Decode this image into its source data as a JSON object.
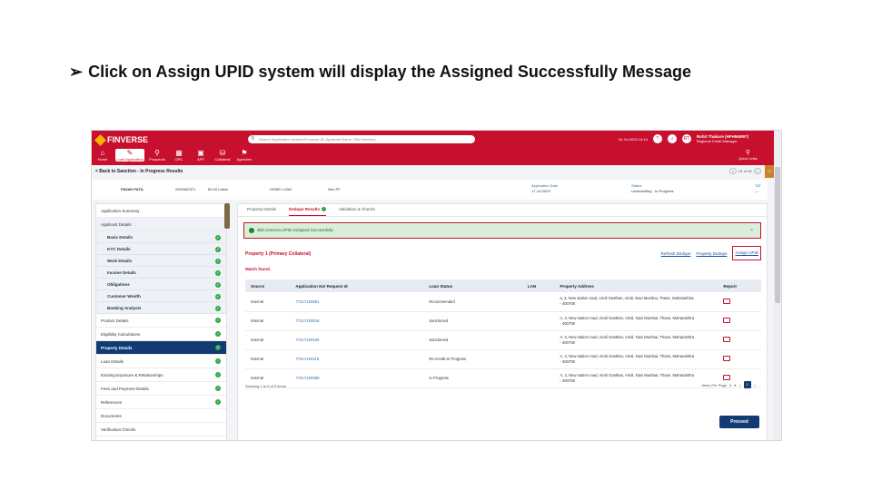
{
  "slide": {
    "bullet": "➢",
    "title": "Click on Assign UPID system will display the Assigned Successfully Message"
  },
  "app": {
    "brand": "FINVERSE",
    "nav": [
      {
        "icon": "⌂",
        "label": "Home"
      },
      {
        "icon": "✎",
        "label": "Loan Application"
      },
      {
        "icon": "⚲",
        "label": "Prospects"
      },
      {
        "icon": "▦",
        "label": "OPC"
      },
      {
        "icon": "▣",
        "label": "APF"
      },
      {
        "icon": "⛁",
        "label": "Collateral"
      },
      {
        "icon": "⚑",
        "label": "Agencies"
      }
    ],
    "search_placeholder": "Search (Application Number/Finverse ID, Applicant Name, PAN Number)",
    "datetime": "04 Jul 2023 14:14",
    "user_name": "Rohit Thakare (HFHM4997)",
    "user_role": "Regional Credit Manager",
    "user_initials": "RT",
    "quick_links": "Quick Links"
  },
  "crumb": "< Back to Sanction - In Progress Results",
  "pager": {
    "text": "01 of 05"
  },
  "info": {
    "name": "PAVAN PATIL",
    "app_no": "2000082371",
    "amount": "80.00 Lakhs",
    "product": "HOME LOAN",
    "dpd": "Non RT",
    "app_date_label": "Application Date",
    "app_date": "17 Jul 2023",
    "status_label": "Status",
    "status": "Underwriting - In Progress",
    "tat_label": "TAT",
    "tat": "—"
  },
  "sidebar": [
    {
      "label": "Application Summary",
      "type": "item",
      "check": false
    },
    {
      "label": "Applicant Details",
      "type": "group",
      "check": false
    },
    {
      "label": "Basic Details",
      "type": "sub",
      "check": true
    },
    {
      "label": "KYC Details",
      "type": "sub",
      "check": true
    },
    {
      "label": "Work Details",
      "type": "sub",
      "check": true
    },
    {
      "label": "Income Details",
      "type": "sub",
      "check": true
    },
    {
      "label": "Obligations",
      "type": "sub",
      "check": true
    },
    {
      "label": "Customer Wealth",
      "type": "sub",
      "check": true
    },
    {
      "label": "Banking Analysis",
      "type": "sub",
      "check": true
    },
    {
      "label": "Product Details",
      "type": "item",
      "check": true
    },
    {
      "label": "Eligibility Calculations",
      "type": "item",
      "check": true
    },
    {
      "label": "Property Details",
      "type": "active",
      "check": true
    },
    {
      "label": "Loan Details",
      "type": "item",
      "check": true
    },
    {
      "label": "Existing Exposure & Relationships",
      "type": "item",
      "check": true
    },
    {
      "label": "Fees and Payment Details",
      "type": "item",
      "check": true
    },
    {
      "label": "References",
      "type": "item",
      "check": true
    },
    {
      "label": "Documents",
      "type": "item",
      "check": false
    },
    {
      "label": "Verification Checks",
      "type": "item",
      "check": false
    },
    {
      "label": "Sourcing Details",
      "type": "item",
      "check": true
    }
  ],
  "tabs": [
    {
      "label": "Property Details",
      "active": false
    },
    {
      "label": "Dedupe Results",
      "active": true
    },
    {
      "label": "Validation & Checks",
      "active": false
    }
  ],
  "success_message": "dbd.common.UPID Assigned Successfully",
  "property_title": "Property 1 (Primary Collateral)",
  "actions": {
    "refresh": "Refresh Dedupe",
    "property_dedupe": "Property Dedupe",
    "assign": "Assign UPID"
  },
  "match_text": "Match found.",
  "table": {
    "headers": [
      "Source",
      "Application No/ Request Id",
      "Loan Status",
      "LAN",
      "Property Address",
      "Report"
    ],
    "rows": [
      {
        "source": "Internal",
        "app": "7721Y100091",
        "status": "Recommended",
        "lan": "",
        "addr1": "a, 3, New station road, Airoli Gasthan, Airoli, Navi Mumbai, Thane, Maharashtra",
        "addr2": "- 400708"
      },
      {
        "source": "Internal",
        "app": "7721Y100016",
        "status": "Sanctioned",
        "lan": "",
        "addr1": "A, 3, New station road, Airoli Gasthan, Airoli, Navi Mumbai, Thane, Maharashtra",
        "addr2": "- 400708"
      },
      {
        "source": "Internal",
        "app": "7721Y100105",
        "status": "Sanctioned",
        "lan": "",
        "addr1": "A, 3, New station road, Airoli Gasthan, Airoli, Navi Mumbai, Thane, Maharashtra",
        "addr2": "- 400708"
      },
      {
        "source": "Internal",
        "app": "7721Y100118",
        "status": "Re-Credit-In Progress",
        "lan": "",
        "addr1": "A, 3, New station road, Airoli Gasthan, Airoli, Navi Mumbai, Thane, Maharashtra",
        "addr2": "- 400708"
      },
      {
        "source": "Internal",
        "app": "7721Y100089",
        "status": "In Progress",
        "lan": "",
        "addr1": "A, 3, New station road, Airoli Gasthan, Airoli, Navi Mumbai, Thane, Maharashtra",
        "addr2": "- 400708"
      }
    ]
  },
  "showing": "Showing 1 to 5 of 5 items",
  "rows_per_page": "Items Per Page",
  "rows_per_page_value": "5",
  "page_current": "1",
  "proceed": "Proceed"
}
